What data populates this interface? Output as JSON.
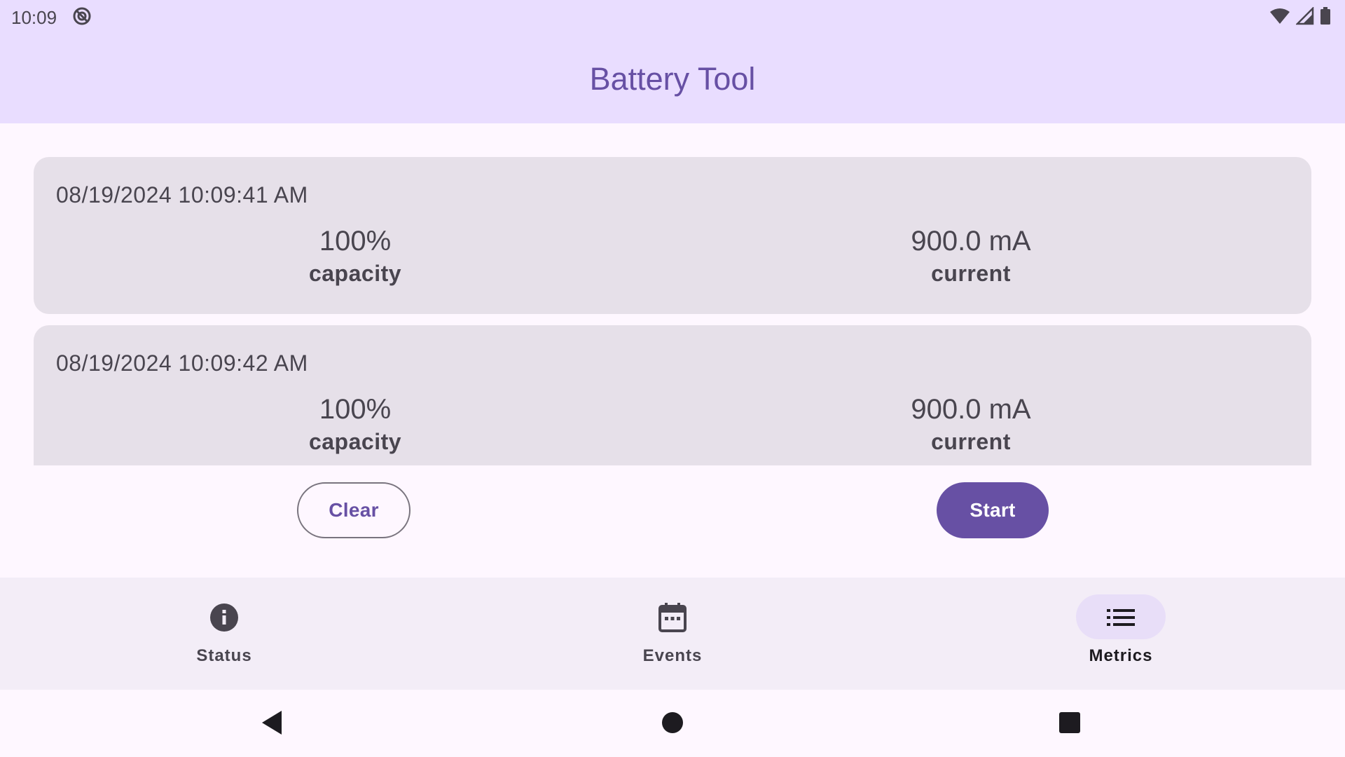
{
  "status_bar": {
    "time": "10:09",
    "icons": [
      "data-saver-icon",
      "wifi-icon",
      "cellular-signal-icon",
      "battery-icon"
    ]
  },
  "app_bar": {
    "title": "Battery Tool"
  },
  "records": [
    {
      "timestamp": "08/19/2024 10:09:41 AM",
      "capacity_value": "100%",
      "capacity_label": "capacity",
      "current_value": "900.0 mA",
      "current_label": "current"
    },
    {
      "timestamp": "08/19/2024 10:09:42 AM",
      "capacity_value": "100%",
      "capacity_label": "capacity",
      "current_value": "900.0 mA",
      "current_label": "current"
    }
  ],
  "actions": {
    "clear_label": "Clear",
    "start_label": "Start"
  },
  "bottom_nav": {
    "items": [
      {
        "label": "Status",
        "icon": "info-icon",
        "active": false
      },
      {
        "label": "Events",
        "icon": "calendar-icon",
        "active": false
      },
      {
        "label": "Metrics",
        "icon": "list-icon",
        "active": true
      }
    ]
  },
  "system_nav": {
    "icons": [
      "back-icon",
      "home-icon",
      "recents-icon"
    ]
  },
  "colors": {
    "primary": "#6750a4",
    "app_bar_bg": "#e9ddff",
    "card_bg": "#e6e0e9",
    "nav_bg": "#f3edf7",
    "nav_indicator": "#e8def8",
    "surface": "#fef7ff"
  }
}
